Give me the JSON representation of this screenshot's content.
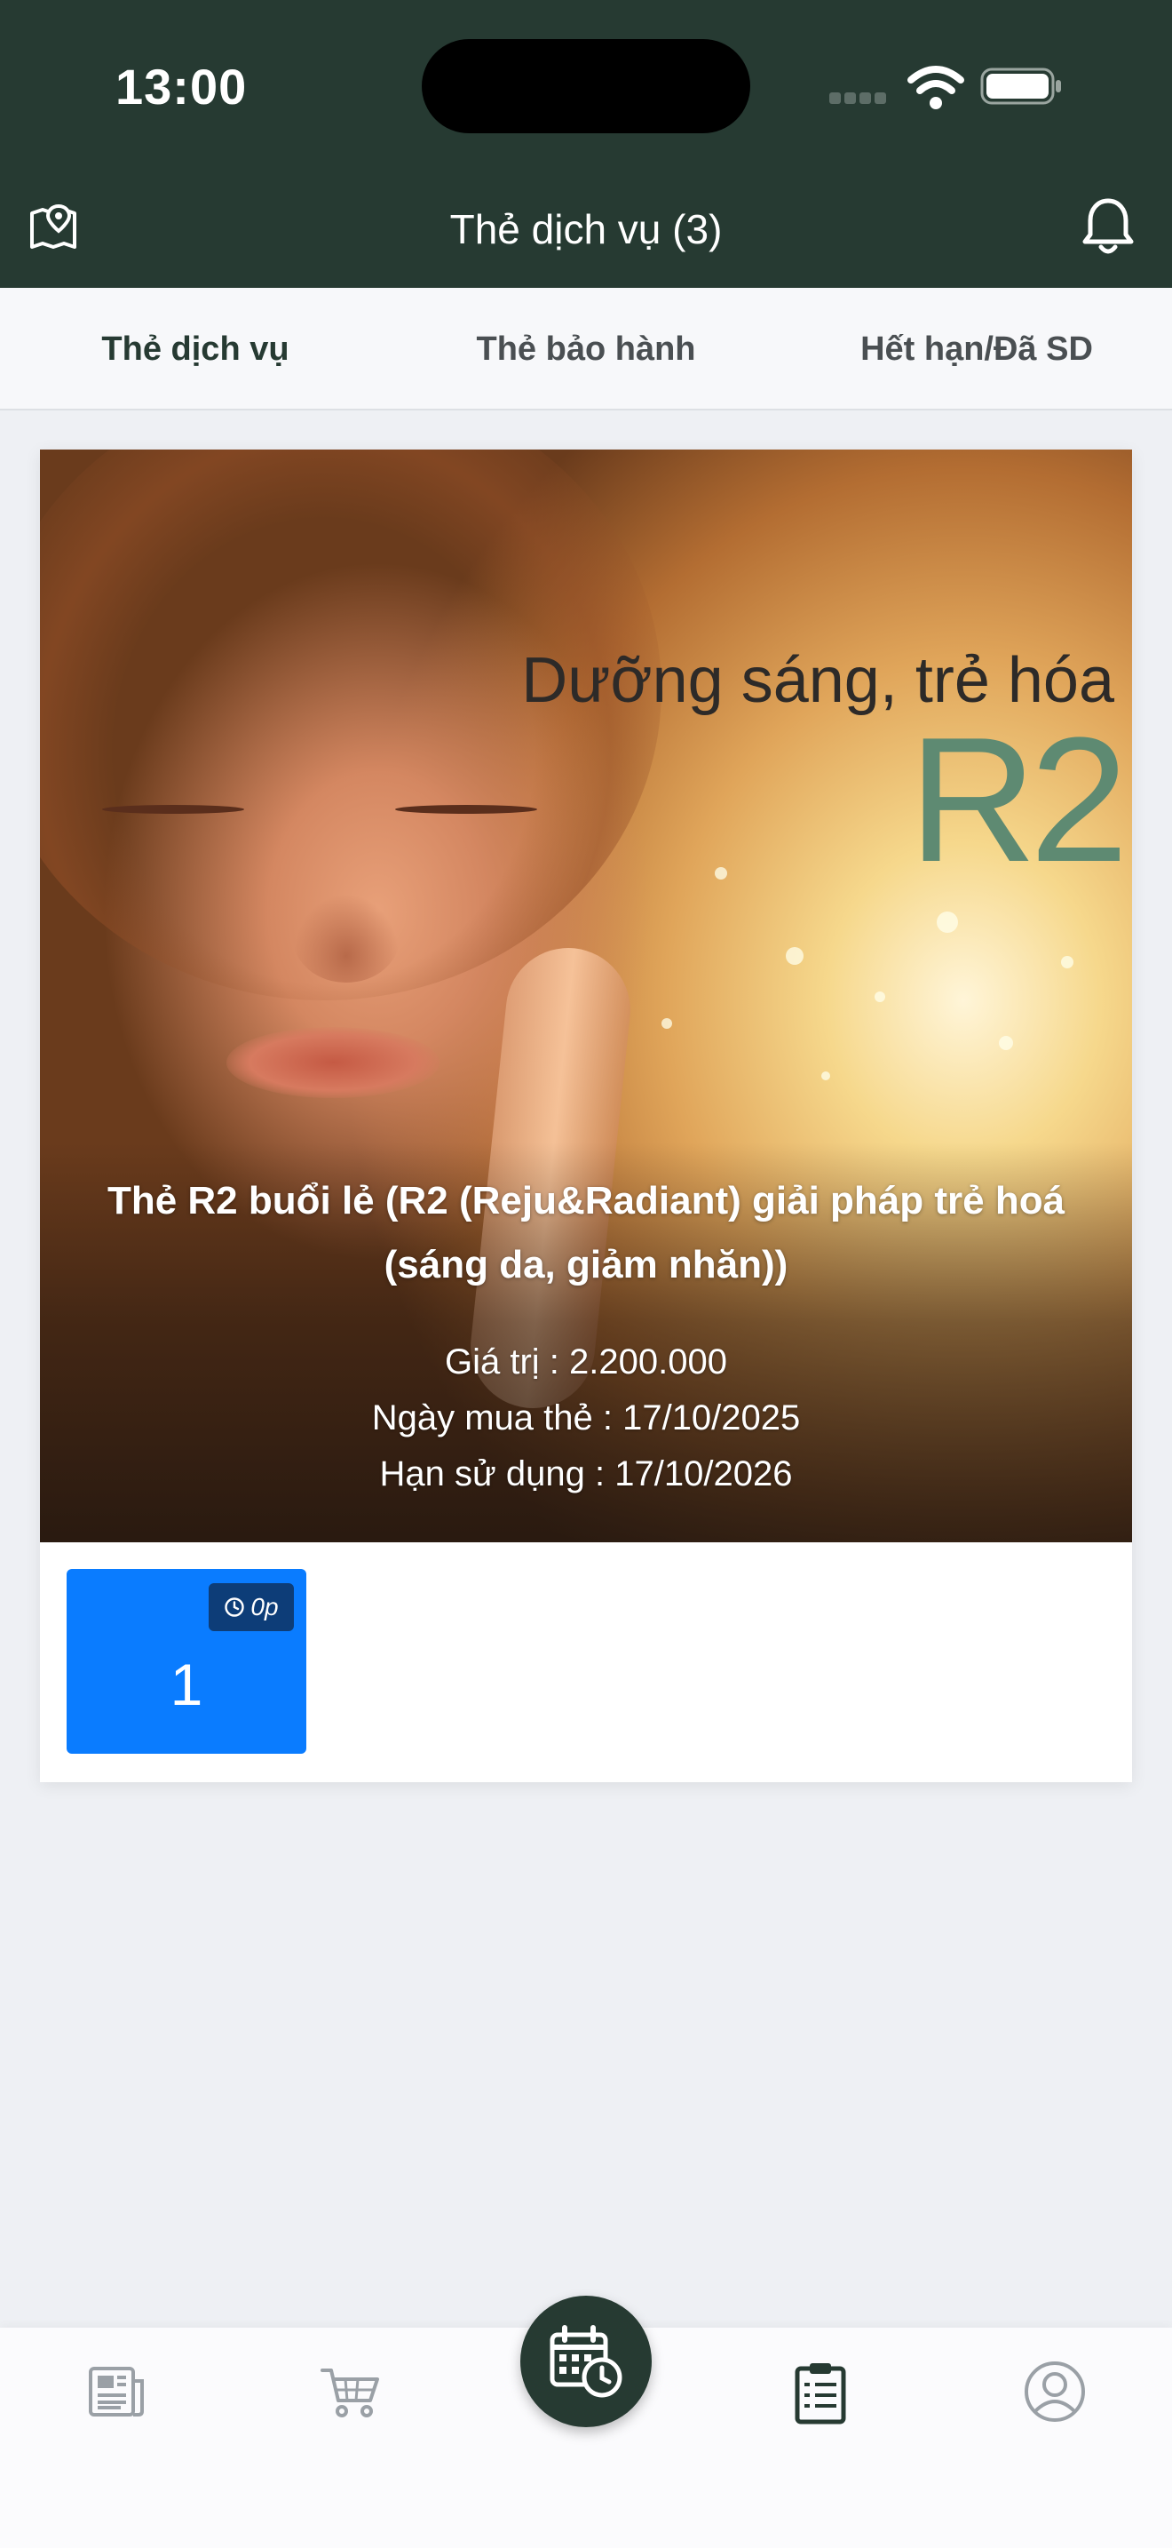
{
  "status_bar": {
    "time": "13:00"
  },
  "header": {
    "title": "Thẻ dịch vụ (3)"
  },
  "tabs": [
    {
      "label": "Thẻ dịch vụ",
      "active": true
    },
    {
      "label": "Thẻ bảo hành",
      "active": false
    },
    {
      "label": "Hết hạn/Đã SD",
      "active": false
    }
  ],
  "card": {
    "banner": {
      "tagline": "Dưỡng sáng, trẻ hóa",
      "brand": "R2"
    },
    "title": "Thẻ R2 buổi lẻ (R2 (Reju&Radiant) giải pháp trẻ hoá (sáng da, giảm nhăn))",
    "value_line": "Giá trị : 2.200.000",
    "purchase_line": "Ngày mua thẻ : 17/10/2025",
    "expiry_line": "Hạn sử dụng : 17/10/2026",
    "session": {
      "number": "1",
      "duration": "0p"
    }
  },
  "bottom_nav": [
    {
      "icon": "news-icon"
    },
    {
      "icon": "cart-icon"
    },
    {
      "icon": "calendar-clock-icon",
      "center": true
    },
    {
      "icon": "clipboard-icon",
      "active": true
    },
    {
      "icon": "account-icon"
    }
  ],
  "colors": {
    "header_bg": "#263a32",
    "session_tile": "#0a7cff",
    "badge_bg": "#0d3d78",
    "brand_green": "#5e8a72"
  }
}
